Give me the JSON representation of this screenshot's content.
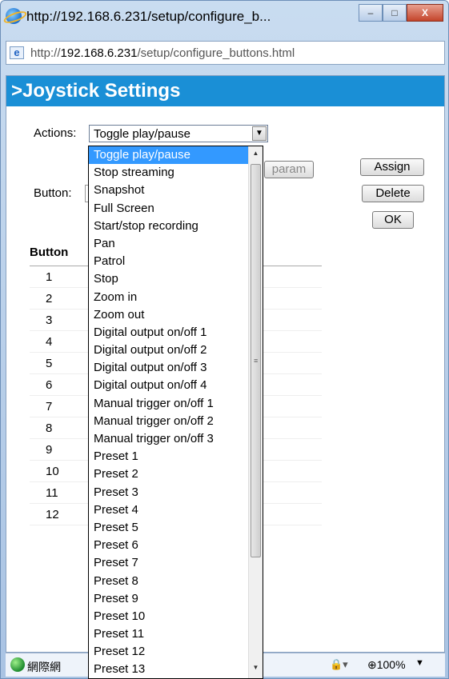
{
  "window": {
    "title": "http://192.168.6.231/setup/configure_b...",
    "controls": [
      "–",
      "□",
      "X"
    ]
  },
  "address": {
    "prefix": "http://",
    "host": "192.168.6.231",
    "path": "/setup/configure_buttons.html"
  },
  "page": {
    "heading": ">Joystick Settings",
    "actions_label": "Actions:",
    "actions_value": "Toggle play/pause",
    "button_label": "Button:",
    "param_button": "param",
    "assign_button": "Assign",
    "delete_button": "Delete",
    "ok_button": "OK",
    "table_header": "Button",
    "rows": [
      "1",
      "2",
      "3",
      "4",
      "5",
      "6",
      "7",
      "8",
      "9",
      "10",
      "11",
      "12"
    ]
  },
  "dropdown": {
    "options": [
      "Toggle play/pause",
      "Stop streaming",
      "Snapshot",
      "Full Screen",
      "Start/stop recording",
      "Pan",
      "Patrol",
      "Stop",
      "Zoom in",
      "Zoom out",
      "Digital output on/off 1",
      "Digital output on/off 2",
      "Digital output on/off 3",
      "Digital output on/off 4",
      "Manual trigger on/off 1",
      "Manual trigger on/off 2",
      "Manual trigger on/off 3",
      "Preset 1",
      "Preset 2",
      "Preset 3",
      "Preset 4",
      "Preset 5",
      "Preset 6",
      "Preset 7",
      "Preset 8",
      "Preset 9",
      "Preset 10",
      "Preset 11",
      "Preset 12",
      "Preset 13"
    ],
    "selected_index": 0
  },
  "statusbar": {
    "text": "網際網",
    "zoom": "100%"
  },
  "colors": {
    "heading_bg": "#1a8fd6",
    "selected_bg": "#3399ff"
  },
  "icons": [
    "ie-icon",
    "page-icon",
    "globe-icon",
    "zone-icon",
    "zoom-icon"
  ]
}
